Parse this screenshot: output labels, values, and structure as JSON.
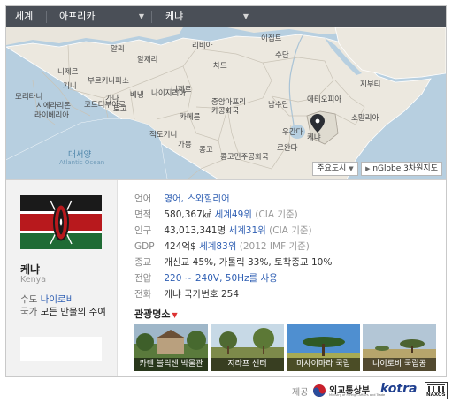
{
  "breadcrumb": {
    "items": [
      {
        "label": "세계"
      },
      {
        "label": "아프리카"
      },
      {
        "label": "케냐"
      }
    ]
  },
  "map": {
    "labels": [
      "알리",
      "이집트",
      "리비아",
      "알제리",
      "차드",
      "수단",
      "부르키나파소",
      "니제르",
      "모리타니",
      "니제르",
      "나이지리아",
      "베냉",
      "기니",
      "토고",
      "가나",
      "코트디부아르",
      "시에라리온",
      "라이베리아",
      "중앙아프리카공화국",
      "카메룬",
      "남수단",
      "에티오피아",
      "지부티",
      "소말리아",
      "우간다",
      "케냐",
      "적도기니",
      "가봉",
      "콩고",
      "콩고민주공화국",
      "르완다"
    ],
    "sea_label": "대서양",
    "sea_label_en": "Atlantic Ocean",
    "marker_label": "케냐",
    "buttons": {
      "cities": "주요도시",
      "nglobe": "nGlobe 3차원지도"
    }
  },
  "country": {
    "name": "케냐",
    "name_en": "Kenya",
    "capital_key": "수도",
    "capital": "나이로비",
    "anthem_key": "국가",
    "anthem": "모든 만물의 주여",
    "flag_colors": {
      "black": "#1a1a1a",
      "red": "#b8191d",
      "green": "#1f6b35",
      "white": "#ffffff"
    }
  },
  "facts": {
    "language": {
      "key": "언어",
      "value": "영어, 스와힐리어"
    },
    "area": {
      "key": "면적",
      "value": "580,367㎢",
      "rank": "세계49위",
      "note": "(CIA 기준)"
    },
    "population": {
      "key": "인구",
      "value": "43,013,341명",
      "rank": "세계31위",
      "note": "(CIA 기준)"
    },
    "gdp": {
      "key": "GDP",
      "value": "424억$",
      "rank": "세계83위",
      "note": "(2012 IMF 기준)"
    },
    "religion": {
      "key": "종교",
      "value": "개신교 45%, 가톨릭 33%, 토착종교 10%"
    },
    "voltage": {
      "key": "전압",
      "value": "220 ~ 240V, 50Hz를 사용"
    },
    "phone": {
      "key": "전화",
      "value": "케냐 국가번호 254"
    }
  },
  "sights": {
    "heading": "관광명소",
    "items": [
      {
        "label": "카렌 블릭센 박물관"
      },
      {
        "label": "지라프 센터"
      },
      {
        "label": "마사이마라 국립"
      },
      {
        "label": "나이로비 국립공"
      }
    ]
  },
  "footer": {
    "provider_label": "제공",
    "providers": [
      "외교통상부",
      "kotra",
      "NAXOS"
    ],
    "mofa_sub": "Ministry of Foreign Affairs and Trade"
  }
}
